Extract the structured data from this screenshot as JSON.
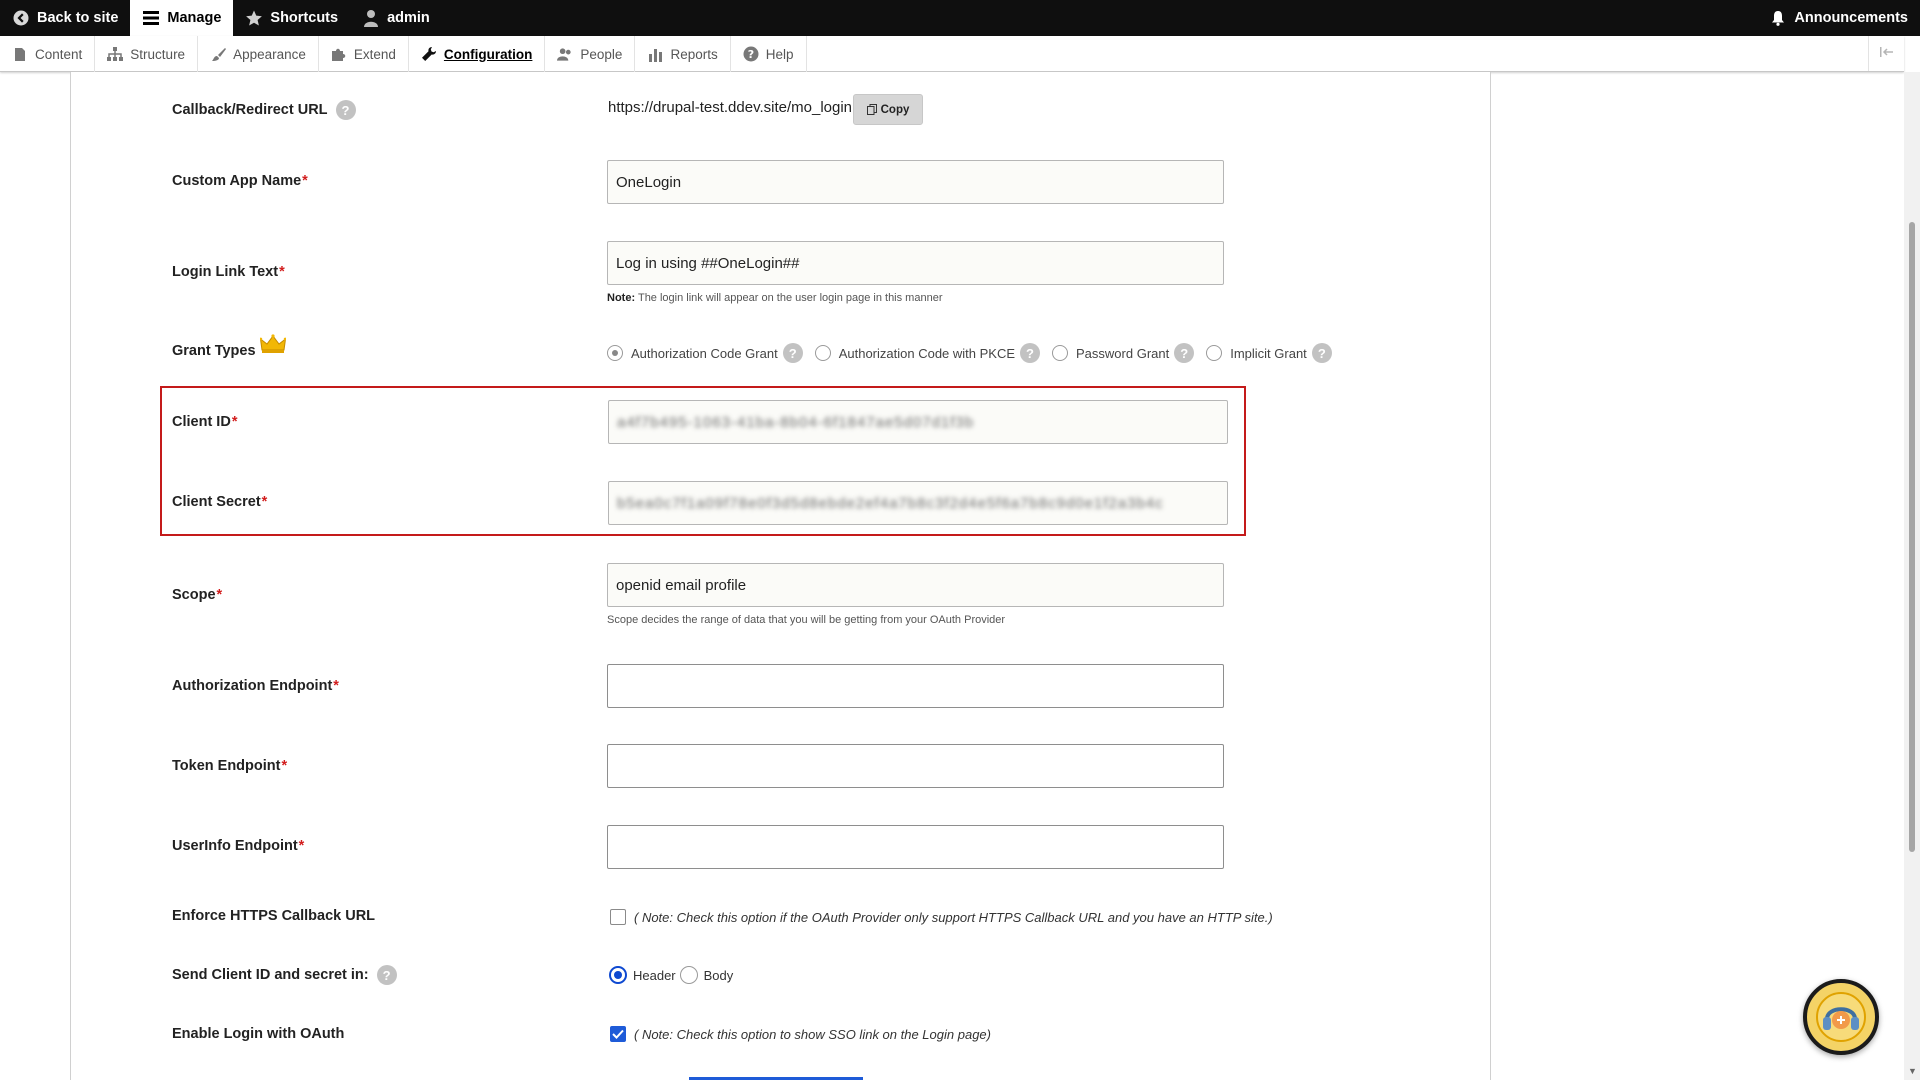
{
  "toolbar": {
    "back_to_site": "Back to site",
    "manage": "Manage",
    "shortcuts": "Shortcuts",
    "user": "admin",
    "announcements": "Announcements"
  },
  "tray": {
    "items": [
      "Content",
      "Structure",
      "Appearance",
      "Extend",
      "Configuration",
      "People",
      "Reports",
      "Help"
    ],
    "active": "Configuration"
  },
  "form": {
    "callback": {
      "label": "Callback/Redirect URL",
      "value": "https://drupal-test.ddev.site/mo_login",
      "copy_label": "Copy"
    },
    "app_name": {
      "label": "Custom App Name",
      "value": "OneLogin"
    },
    "login_link": {
      "label": "Login Link Text",
      "value": "Log in using ##OneLogin##",
      "note_prefix": "Note:",
      "note": "The login link will appear on the user login page in this manner"
    },
    "grant_types": {
      "label": "Grant Types",
      "options": [
        "Authorization Code Grant",
        "Authorization Code with PKCE",
        "Password Grant",
        "Implicit Grant"
      ],
      "selected": "Authorization Code Grant"
    },
    "client_id": {
      "label": "Client ID",
      "value": "a4f7b495-1063-41ba-8b04-6f1847ae5d07d1f3b"
    },
    "client_secret": {
      "label": "Client Secret",
      "value": "b5ea0c7f1a09f78e0f3d5d8ebde2ef4a7b8c3f2d4e5f6a7b8c9d0e1f2a3b4c"
    },
    "scope": {
      "label": "Scope",
      "value": "openid email profile",
      "note": "Scope decides the range of data that you will be getting from your OAuth Provider"
    },
    "auth_endpoint": {
      "label": "Authorization Endpoint",
      "value": ""
    },
    "token_endpoint": {
      "label": "Token Endpoint",
      "value": ""
    },
    "userinfo_endpoint": {
      "label": "UserInfo Endpoint",
      "value": ""
    },
    "enforce_https": {
      "label": "Enforce HTTPS Callback URL",
      "checked": false,
      "note": "( Note: Check this option if the OAuth Provider only support HTTPS Callback URL and you have an HTTP site.)"
    },
    "send_credentials": {
      "label": "Send Client ID and secret in:",
      "options": [
        "Header",
        "Body"
      ],
      "selected": "Header"
    },
    "enable_login": {
      "label": "Enable Login with OAuth",
      "checked": true,
      "note": "( Note: Check this option to show SSO link on the Login page)"
    }
  },
  "colors": {
    "required": "#d21d1d",
    "highlight": "#c41a1a",
    "accent": "#1e5bd8",
    "toolbar": "#0f0f0f"
  }
}
